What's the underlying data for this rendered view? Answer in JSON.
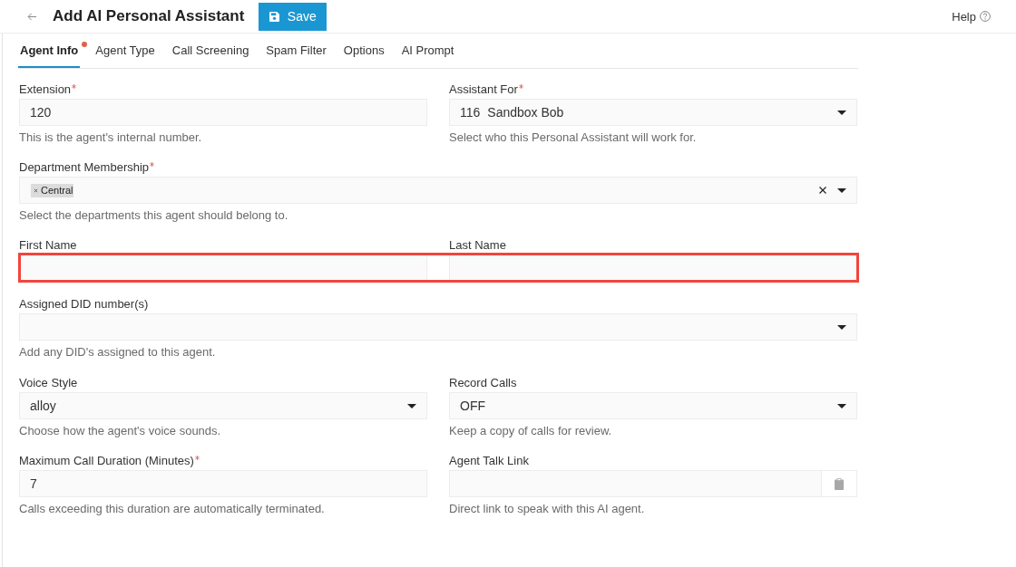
{
  "header": {
    "title": "Add AI Personal Assistant",
    "save_label": "Save",
    "help_label": "Help"
  },
  "tabs": [
    {
      "label": "Agent Info",
      "selected": true,
      "alert": true
    },
    {
      "label": "Agent Type",
      "selected": false,
      "alert": false
    },
    {
      "label": "Call Screening",
      "selected": false,
      "alert": false
    },
    {
      "label": "Spam Filter",
      "selected": false,
      "alert": false
    },
    {
      "label": "Options",
      "selected": false,
      "alert": false
    },
    {
      "label": "AI Prompt",
      "selected": false,
      "alert": false
    }
  ],
  "form": {
    "rows": [
      {
        "highlighted": false,
        "fields": [
          {
            "kind": "text",
            "label": "Extension",
            "required": true,
            "value": "120",
            "help": "This is the agent's internal number."
          },
          {
            "kind": "select",
            "label": "Assistant For",
            "required": true,
            "code": "116",
            "value": "Sandbox Bob",
            "help": "Select who this Personal Assistant will work for."
          }
        ]
      },
      {
        "highlighted": false,
        "fields": [
          {
            "kind": "tags",
            "label": "Department Membership",
            "required": true,
            "tags": [
              "Central"
            ],
            "clearable": true,
            "help": "Select the departments this agent should belong to."
          }
        ]
      },
      {
        "highlighted": true,
        "fields": [
          {
            "kind": "text",
            "label": "First Name",
            "required": false
          },
          {
            "kind": "text",
            "label": "Last Name",
            "required": false
          }
        ]
      },
      {
        "highlighted": false,
        "fields": [
          {
            "kind": "select",
            "label": "Assigned DID number(s)",
            "required": false,
            "help": "Add any DID's assigned to this agent."
          }
        ]
      },
      {
        "highlighted": false,
        "fields": [
          {
            "kind": "select",
            "label": "Voice Style",
            "required": false,
            "value": "alloy",
            "help": "Choose how the agent's voice sounds."
          },
          {
            "kind": "select",
            "label": "Record Calls",
            "required": false,
            "value": "OFF",
            "help": "Keep a copy of calls for review."
          }
        ]
      },
      {
        "highlighted": false,
        "fields": [
          {
            "kind": "text",
            "label": "Maximum Call Duration (Minutes)",
            "required": true,
            "value": "7",
            "help": "Calls exceeding this duration are automatically terminated."
          },
          {
            "kind": "link",
            "label": "Agent Talk Link",
            "required": false,
            "help": "Direct link to speak with this AI agent."
          }
        ]
      }
    ]
  }
}
